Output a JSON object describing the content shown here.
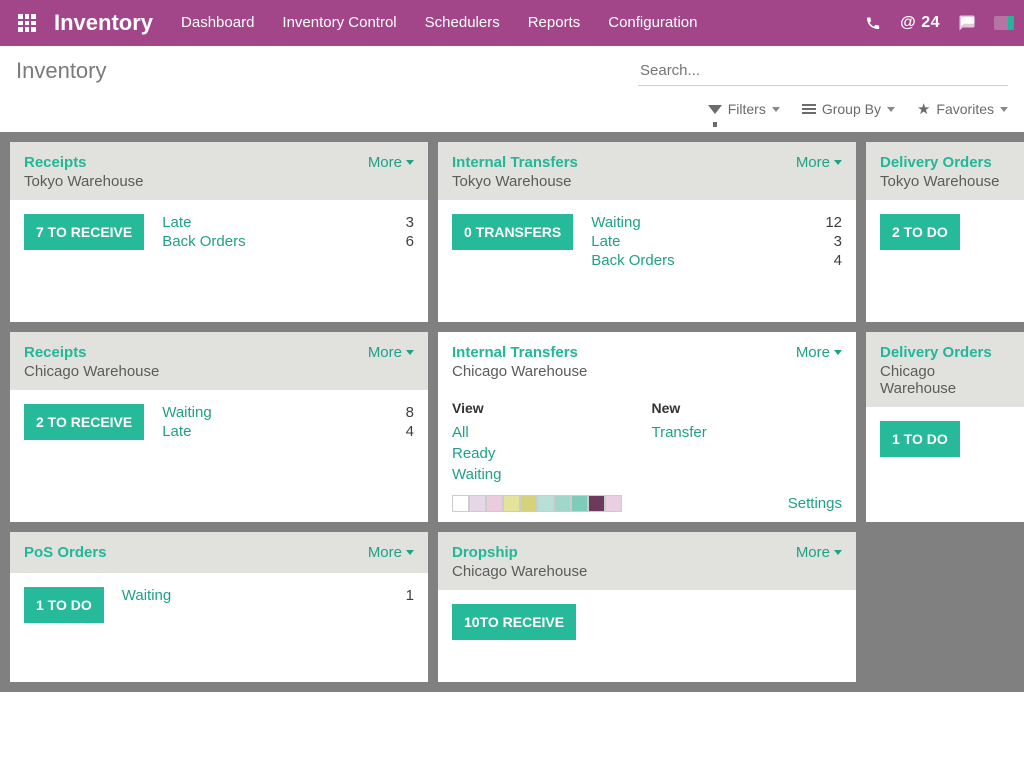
{
  "topbar": {
    "brand": "Inventory",
    "nav": [
      "Dashboard",
      "Inventory Control",
      "Schedulers",
      "Reports",
      "Configuration"
    ],
    "at_count": "@ 24"
  },
  "control": {
    "title": "Inventory",
    "search_placeholder": "Search...",
    "filters_label": "Filters",
    "groupby_label": "Group By",
    "favorites_label": "Favorites"
  },
  "more_label": "More",
  "cards": {
    "c0": {
      "title": "Receipts",
      "sub": "Tokyo Warehouse",
      "action": "7 TO RECEIVE",
      "stats": [
        [
          "Late",
          "3"
        ],
        [
          "Back Orders",
          "6"
        ]
      ]
    },
    "c1": {
      "title": "Internal Transfers",
      "sub": "Tokyo Warehouse",
      "action": "0 TRANSFERS",
      "stats": [
        [
          "Waiting",
          "12"
        ],
        [
          "Late",
          "3"
        ],
        [
          "Back Orders",
          "4"
        ]
      ]
    },
    "c2": {
      "title": "Delivery Orders",
      "sub": "Tokyo Warehouse",
      "action": "2 TO DO"
    },
    "c3": {
      "title": "Receipts",
      "sub": "Chicago Warehouse",
      "action": "2 TO RECEIVE",
      "stats": [
        [
          "Waiting",
          "8"
        ],
        [
          "Late",
          "4"
        ]
      ]
    },
    "c4": {
      "title": "Internal Transfers",
      "sub": "Chicago Warehouse",
      "view_h": "View",
      "new_h": "New",
      "view_items": [
        "All",
        "Ready",
        "Waiting"
      ],
      "new_items": [
        "Transfer"
      ],
      "settings": "Settings",
      "swatches": [
        "#ffffff",
        "#e6d7e6",
        "#eccbdc",
        "#e5e39b",
        "#d6d27a",
        "#b8e0d6",
        "#9fd8c8",
        "#7fcbb9",
        "#6b3a5c",
        "#e9cfe1"
      ]
    },
    "c5": {
      "title": "Delivery Orders",
      "sub": "Chicago Warehouse",
      "action": "1 TO DO"
    },
    "c6": {
      "title": "PoS Orders",
      "sub": "",
      "action": "1 TO DO",
      "stats": [
        [
          "Waiting",
          "1"
        ]
      ]
    },
    "c7": {
      "title": "Dropship",
      "sub": "Chicago Warehouse",
      "action": "10TO RECEIVE"
    }
  }
}
